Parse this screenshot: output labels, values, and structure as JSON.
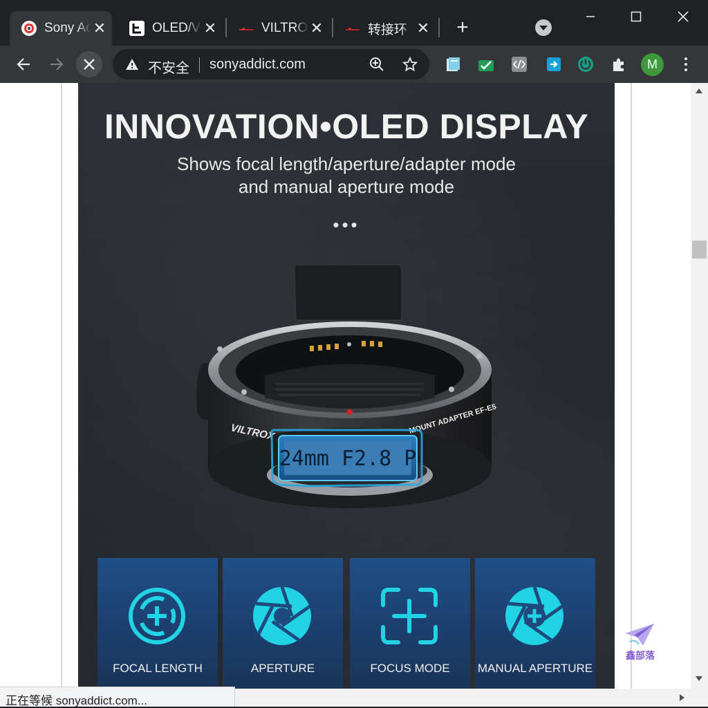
{
  "browser": {
    "tabs": [
      {
        "title": "Sony Addict",
        "active": true,
        "icon": "sony-addict-favicon"
      },
      {
        "title": "OLED/VILTROX",
        "active": false,
        "icon": "letter-e-favicon"
      },
      {
        "title": "VILTROX",
        "active": false,
        "icon": "viltrox-favicon"
      },
      {
        "title": "转接环",
        "active": false,
        "icon": "viltrox-favicon"
      }
    ],
    "close_glyph": "✕",
    "new_tab_glyph": "+",
    "toolbar": {
      "security_label": "不安全",
      "url": "sonyaddict.com",
      "profile_initial": "M"
    },
    "status": "正在等候 sonyaddict.com..."
  },
  "page": {
    "headline": "INNOVATION•OLED DISPLAY",
    "subtitle_line1": "Shows focal length/aperture/adapter mode",
    "subtitle_line2": "and manual aperture mode",
    "dots": "•••",
    "product": {
      "brand": "VILTROX",
      "model_text": "MOUNT ADAPTER EF-E5",
      "lcd_text": "24mm F2.8 P"
    },
    "features": [
      {
        "label": "FOCAL LENGTH",
        "icon": "focal-length-icon"
      },
      {
        "label": "APERTURE",
        "icon": "aperture-icon"
      },
      {
        "label": "FOCUS MODE",
        "icon": "focus-mode-icon"
      },
      {
        "label": "MANUAL APERTURE",
        "icon": "manual-aperture-icon"
      }
    ],
    "watermark": "鑫部落"
  },
  "colors": {
    "accent_cyan": "#22d3e6",
    "card_blue": "#1f4f86",
    "chrome_dark": "#202124",
    "toolbar": "#35363a"
  }
}
